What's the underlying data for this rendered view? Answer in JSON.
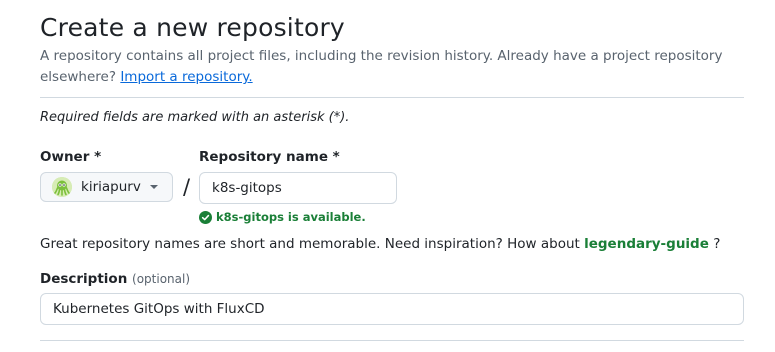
{
  "header": {
    "title": "Create a new repository",
    "subtitle": "A repository contains all project files, including the revision history. Already have a project repository elsewhere?",
    "import_link": "Import a repository."
  },
  "required_note": "Required fields are marked with an asterisk (*).",
  "owner": {
    "label": "Owner *",
    "value": "kiriapurv",
    "avatar_icon": "octopus-avatar-icon"
  },
  "separator": "/",
  "repository": {
    "label": "Repository name *",
    "value": "k8s-gitops",
    "availability": "k8s-gitops is available.",
    "availability_icon": "check-circle-icon"
  },
  "inspiration": {
    "text": "Great repository names are short and memorable. Need inspiration? How about",
    "suggestion": "legendary-guide",
    "suffix": "?"
  },
  "description": {
    "label": "Description",
    "optional": "(optional)",
    "value": "Kubernetes GitOps with FluxCD"
  },
  "colors": {
    "link": "#0969da",
    "success": "#1a7f37",
    "muted": "#59636e",
    "border": "#d1d9e0"
  }
}
